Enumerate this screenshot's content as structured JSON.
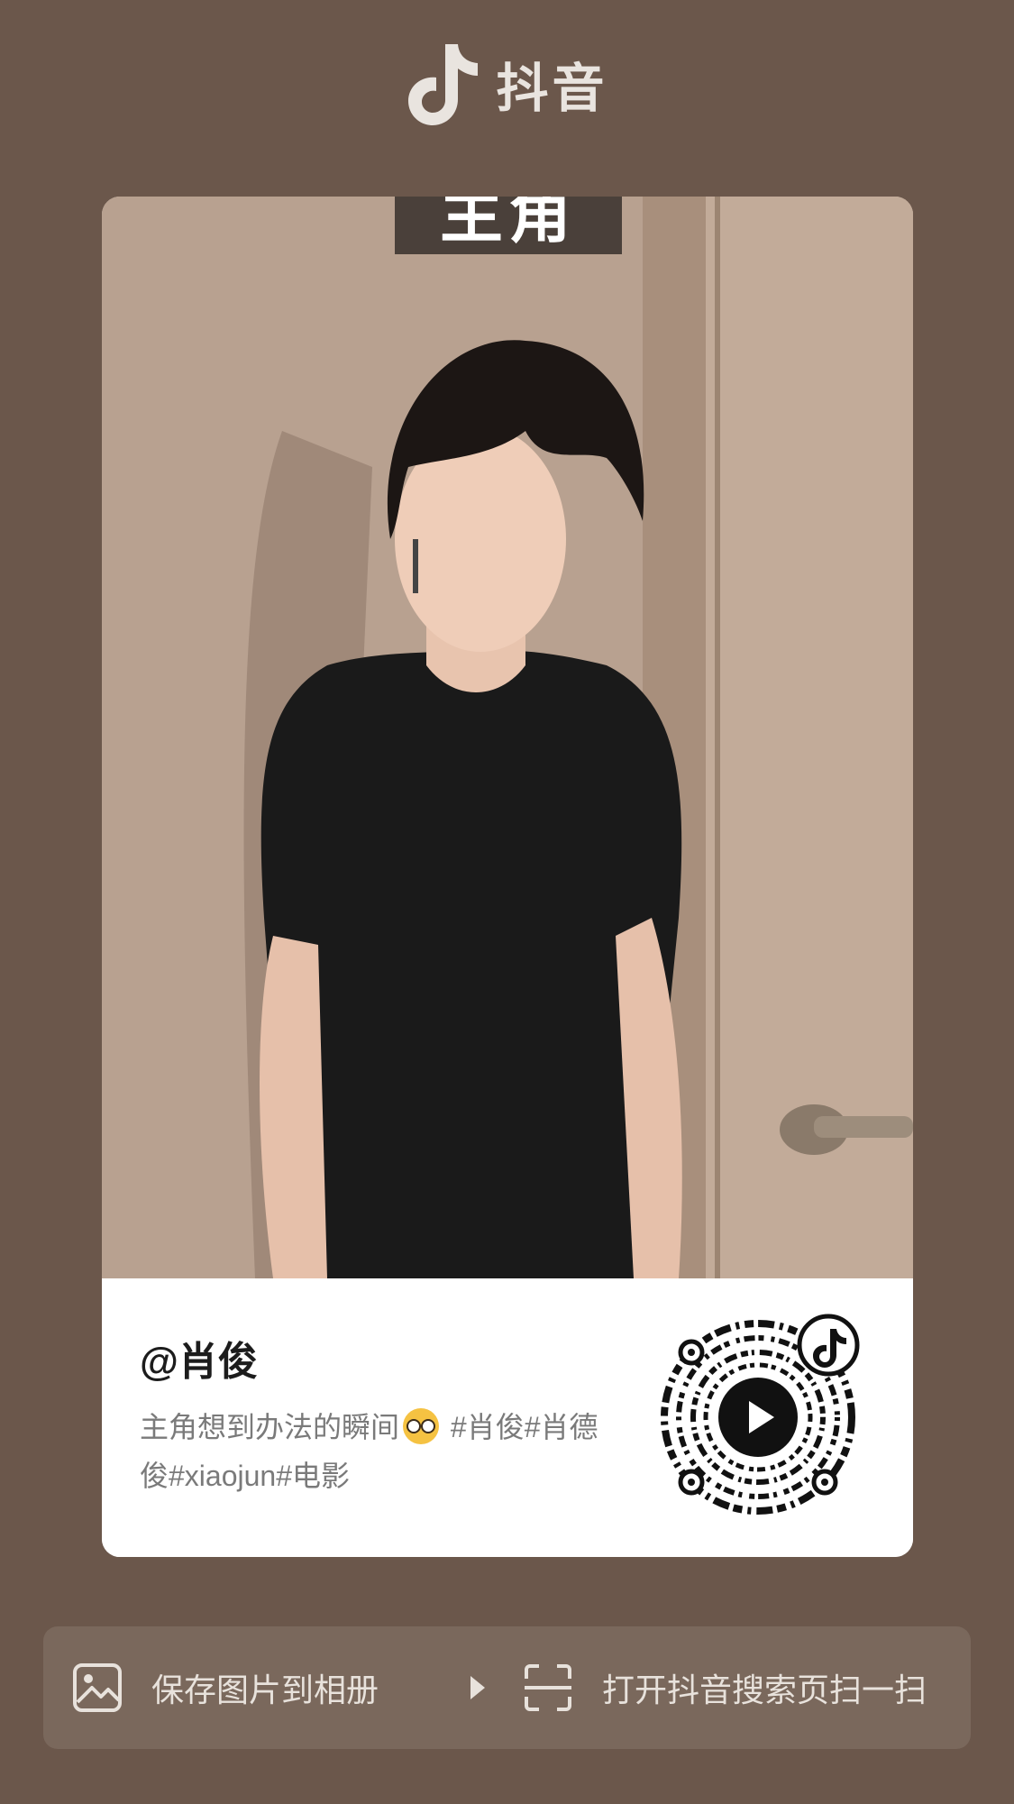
{
  "app": {
    "name": "抖音"
  },
  "cover": {
    "caption": "主角"
  },
  "card": {
    "author": "@肖俊",
    "description_prefix": "主角想到办法的瞬间",
    "description_suffix": " #肖俊#肖德俊#xiaojun#电影",
    "emoji": "nerd-face-emoji"
  },
  "actions": {
    "save_label": "保存图片到相册",
    "scan_label": "打开抖音搜索页扫一扫"
  },
  "colors": {
    "background": "#6b574b",
    "action_bar": "#7a685c",
    "card": "#ffffff"
  }
}
